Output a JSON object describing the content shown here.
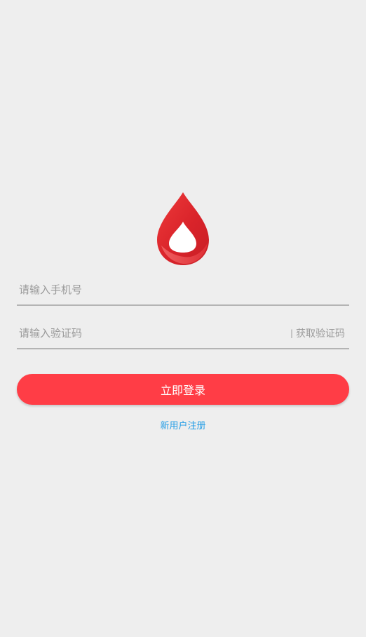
{
  "logo": {
    "icon": "blood-drop-icon",
    "colors": {
      "outer": "#e02a2e",
      "inner": "#ffffff",
      "highlight": "#f05a5a"
    }
  },
  "form": {
    "phone_placeholder": "请输入手机号",
    "phone_value": "",
    "code_placeholder": "请输入验证码",
    "code_value": "",
    "code_separator": "|",
    "get_code_label": "获取验证码"
  },
  "login_button_label": "立即登录",
  "register_link_label": "新用户注册",
  "colors": {
    "background": "#eeeeee",
    "primary": "#ff3d46",
    "link": "#1e9be6",
    "placeholder": "#9a9a9a",
    "underline": "#b4b4b4"
  }
}
